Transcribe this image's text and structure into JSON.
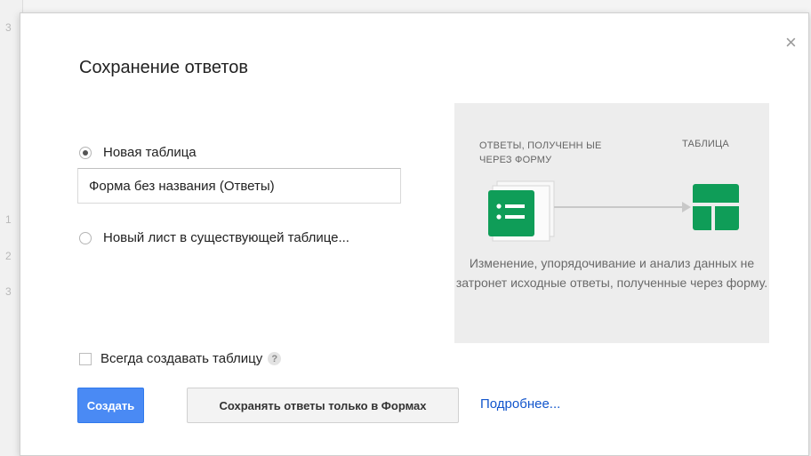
{
  "background": {
    "row_numbers": [
      "3",
      "1",
      "2",
      "3"
    ]
  },
  "dialog": {
    "title": "Сохранение ответов",
    "close_symbol": "×",
    "options": {
      "new_table_label": "Новая таблица",
      "new_table_selected": true,
      "table_name_value": "Форма без названия (Ответы)",
      "existing_table_label": "Новый лист в существующей таблице..."
    },
    "illustration": {
      "source_label": "ОТВЕТЫ, ПОЛУЧЕНН ЫЕ ЧЕРЕЗ ФОРМУ",
      "destination_label": "ТАБЛИЦА",
      "caption": "Изменение, упорядочивание и анализ данных не затронет исходные ответы, полученные через форму.",
      "forms_icon": "forms-icon",
      "sheets_icon": "sheets-icon",
      "accent_color": "#0f9d58"
    },
    "always_create": {
      "label": "Всегда создавать таблицу",
      "checked": false,
      "help_symbol": "?"
    },
    "buttons": {
      "create_label": "Создать",
      "forms_only_label": "Сохранять ответы только в Формах",
      "more_link": "Подробнее..."
    },
    "colors": {
      "primary_button": "#4a8af4",
      "link": "#1155cc"
    }
  }
}
